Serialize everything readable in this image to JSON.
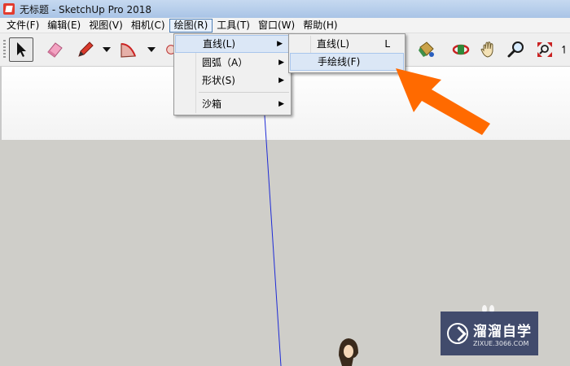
{
  "window": {
    "title": "无标题 - SketchUp Pro 2018"
  },
  "menubar": [
    {
      "label": "文件(F)"
    },
    {
      "label": "编辑(E)"
    },
    {
      "label": "视图(V)"
    },
    {
      "label": "相机(C)"
    },
    {
      "label": "绘图(R)"
    },
    {
      "label": "工具(T)"
    },
    {
      "label": "窗口(W)"
    },
    {
      "label": "帮助(H)"
    }
  ],
  "draw_menu": {
    "items": [
      {
        "label": "直线(L)"
      },
      {
        "label": "圆弧（A）"
      },
      {
        "label": "形状(S)"
      },
      {
        "label": "沙箱"
      }
    ]
  },
  "line_submenu": {
    "items": [
      {
        "label": "直线(L)",
        "shortcut": "L"
      },
      {
        "label": "手绘线(F)"
      }
    ]
  },
  "toolbar": {
    "tools": [
      "select-icon",
      "eraser-icon",
      "pencil-icon",
      "arc-icon",
      "paint-bucket-icon",
      "orbit-icon",
      "pan-icon",
      "zoom-icon",
      "zoom-extents-icon"
    ]
  },
  "watermark": {
    "title": "溜溜自学",
    "subtitle": "ZIXUE.3066.COM"
  },
  "colors": {
    "accent": "#ff6a00",
    "axis_blue": "#1e2bd6",
    "menu_highlight": "#dbe7f6"
  }
}
